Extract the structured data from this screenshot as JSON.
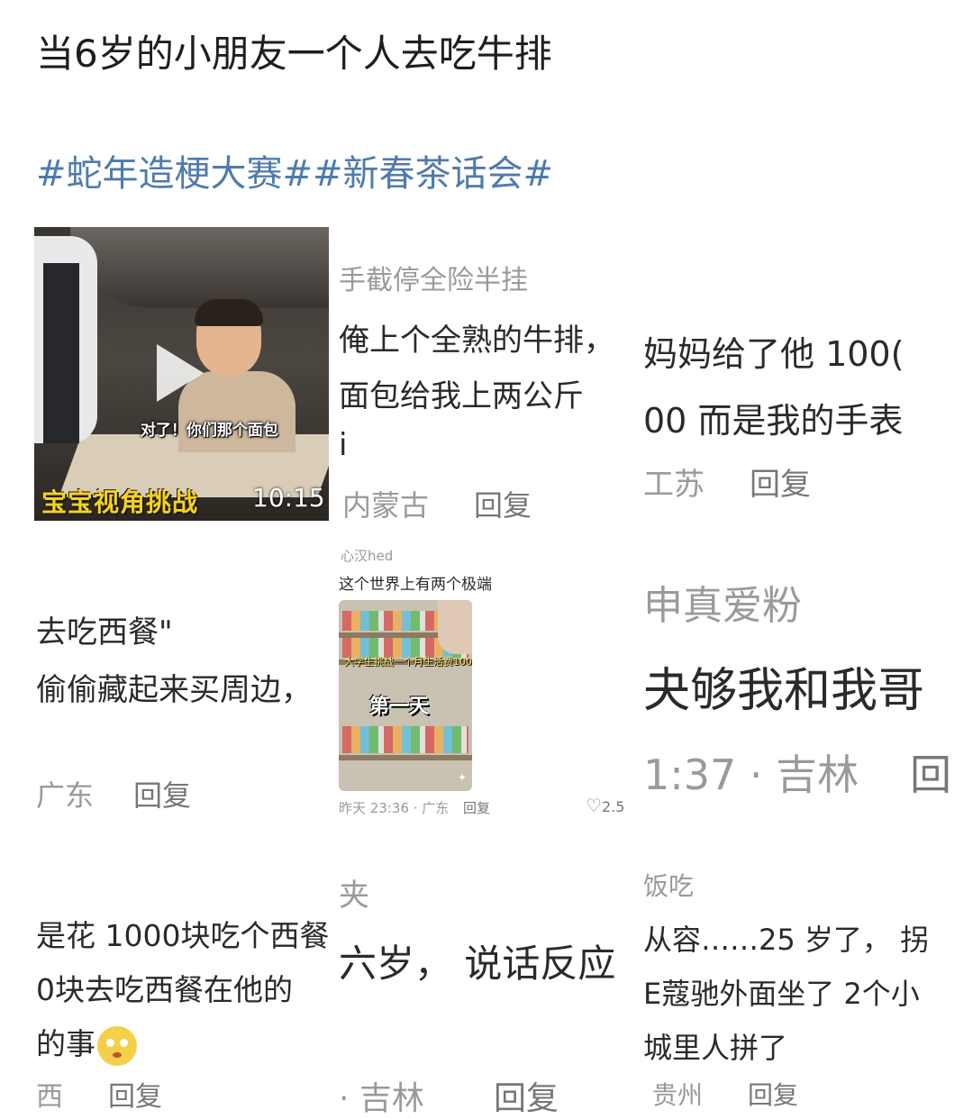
{
  "post": {
    "title": "当6岁的小朋友一个人去吃牛排",
    "tags": "#蛇年造梗大赛##新春茶话会#"
  },
  "video": {
    "caption": "对了！你们那个面包",
    "challenge_label": "宝宝视角挑战",
    "duration": "10:15"
  },
  "comments": {
    "c1": {
      "user": "手截停全险半挂",
      "line1": "俺上个全熟的牛排，",
      "line2": "面包给我上两公斤",
      "line3": "i",
      "location": "内蒙古",
      "reply": "回复"
    },
    "c2": {
      "line1": "妈妈给了他 100(",
      "line2": "00 而是我的手表",
      "location": "工苏",
      "reply": "回复"
    },
    "c3": {
      "line1": "去吃西餐\"",
      "line2": "偷偷藏起来买周边，",
      "location": "广东",
      "reply": "回复"
    },
    "c4": {
      "user": "心汉hed",
      "line1": "这个世界上有两个极端",
      "thumb_text": "大学生挑战一个月生活费1000元",
      "thumb_day": "第一天",
      "meta": "昨天 23:36 · 广东",
      "reply": "回复",
      "likes": "2.5"
    },
    "c5": {
      "user": "申真爱粉",
      "line1": "夬够我和我哥",
      "time_loc": "1:37 · 吉林",
      "reply": "回"
    },
    "c6": {
      "line1": "是花 1000块吃个西餐",
      "line2": "0块去吃西餐在他的",
      "line3": "的事",
      "location": "西",
      "reply": "回复"
    },
    "c7": {
      "user": "夹",
      "line1": "六岁， 说话反应",
      "location": "· 吉林",
      "reply": "回复"
    },
    "c8": {
      "user": "饭吃",
      "line1": "从容……25 岁了， 拐",
      "line2": "E蔻驰外面坐了 2个小",
      "line3": "城里人拼了",
      "location": "贵州",
      "reply": "回复"
    }
  }
}
